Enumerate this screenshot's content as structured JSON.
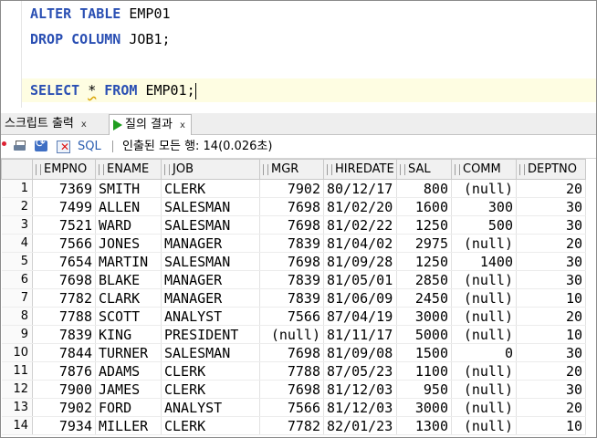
{
  "editor": {
    "line1": {
      "kw1": "ALTER",
      "kw2": "TABLE",
      "rest": "EMP01"
    },
    "line2": {
      "kw1": "DROP",
      "kw2": "COLUMN",
      "rest": "JOB1;"
    },
    "line3": {
      "kw1": "SELECT",
      "star": "*",
      "kw2": "FROM",
      "rest": "EMP01;"
    },
    "keyword_color": "#2a4fb3",
    "current_line_bg": "#fefde2"
  },
  "tabs": [
    {
      "label": "스크립트 출력",
      "close": "x"
    },
    {
      "label": "질의 결과",
      "close": "x",
      "icon": "run-icon"
    }
  ],
  "toolbar": {
    "icons": [
      "pin-icon",
      "print-icon",
      "refresh-icon",
      "delete-icon"
    ],
    "sql_label": "SQL",
    "status": "인출된 모든 행: 14(0.026초)"
  },
  "grid": {
    "columns": [
      "EMPNO",
      "ENAME",
      "JOB",
      "MGR",
      "HIREDATE",
      "SAL",
      "COMM",
      "DEPTNO"
    ],
    "rows": [
      [
        "1",
        "7369",
        "SMITH",
        "CLERK",
        "7902",
        "80/12/17",
        "800",
        "(null)",
        "20"
      ],
      [
        "2",
        "7499",
        "ALLEN",
        "SALESMAN",
        "7698",
        "81/02/20",
        "1600",
        "300",
        "30"
      ],
      [
        "3",
        "7521",
        "WARD",
        "SALESMAN",
        "7698",
        "81/02/22",
        "1250",
        "500",
        "30"
      ],
      [
        "4",
        "7566",
        "JONES",
        "MANAGER",
        "7839",
        "81/04/02",
        "2975",
        "(null)",
        "20"
      ],
      [
        "5",
        "7654",
        "MARTIN",
        "SALESMAN",
        "7698",
        "81/09/28",
        "1250",
        "1400",
        "30"
      ],
      [
        "6",
        "7698",
        "BLAKE",
        "MANAGER",
        "7839",
        "81/05/01",
        "2850",
        "(null)",
        "30"
      ],
      [
        "7",
        "7782",
        "CLARK",
        "MANAGER",
        "7839",
        "81/06/09",
        "2450",
        "(null)",
        "10"
      ],
      [
        "8",
        "7788",
        "SCOTT",
        "ANALYST",
        "7566",
        "87/04/19",
        "3000",
        "(null)",
        "20"
      ],
      [
        "9",
        "7839",
        "KING",
        "PRESIDENT",
        "(null)",
        "81/11/17",
        "5000",
        "(null)",
        "10"
      ],
      [
        "10",
        "7844",
        "TURNER",
        "SALESMAN",
        "7698",
        "81/09/08",
        "1500",
        "0",
        "30"
      ],
      [
        "11",
        "7876",
        "ADAMS",
        "CLERK",
        "7788",
        "87/05/23",
        "1100",
        "(null)",
        "20"
      ],
      [
        "12",
        "7900",
        "JAMES",
        "CLERK",
        "7698",
        "81/12/03",
        "950",
        "(null)",
        "30"
      ],
      [
        "13",
        "7902",
        "FORD",
        "ANALYST",
        "7566",
        "81/12/03",
        "3000",
        "(null)",
        "20"
      ],
      [
        "14",
        "7934",
        "MILLER",
        "CLERK",
        "7782",
        "82/01/23",
        "1300",
        "(null)",
        "10"
      ]
    ]
  }
}
